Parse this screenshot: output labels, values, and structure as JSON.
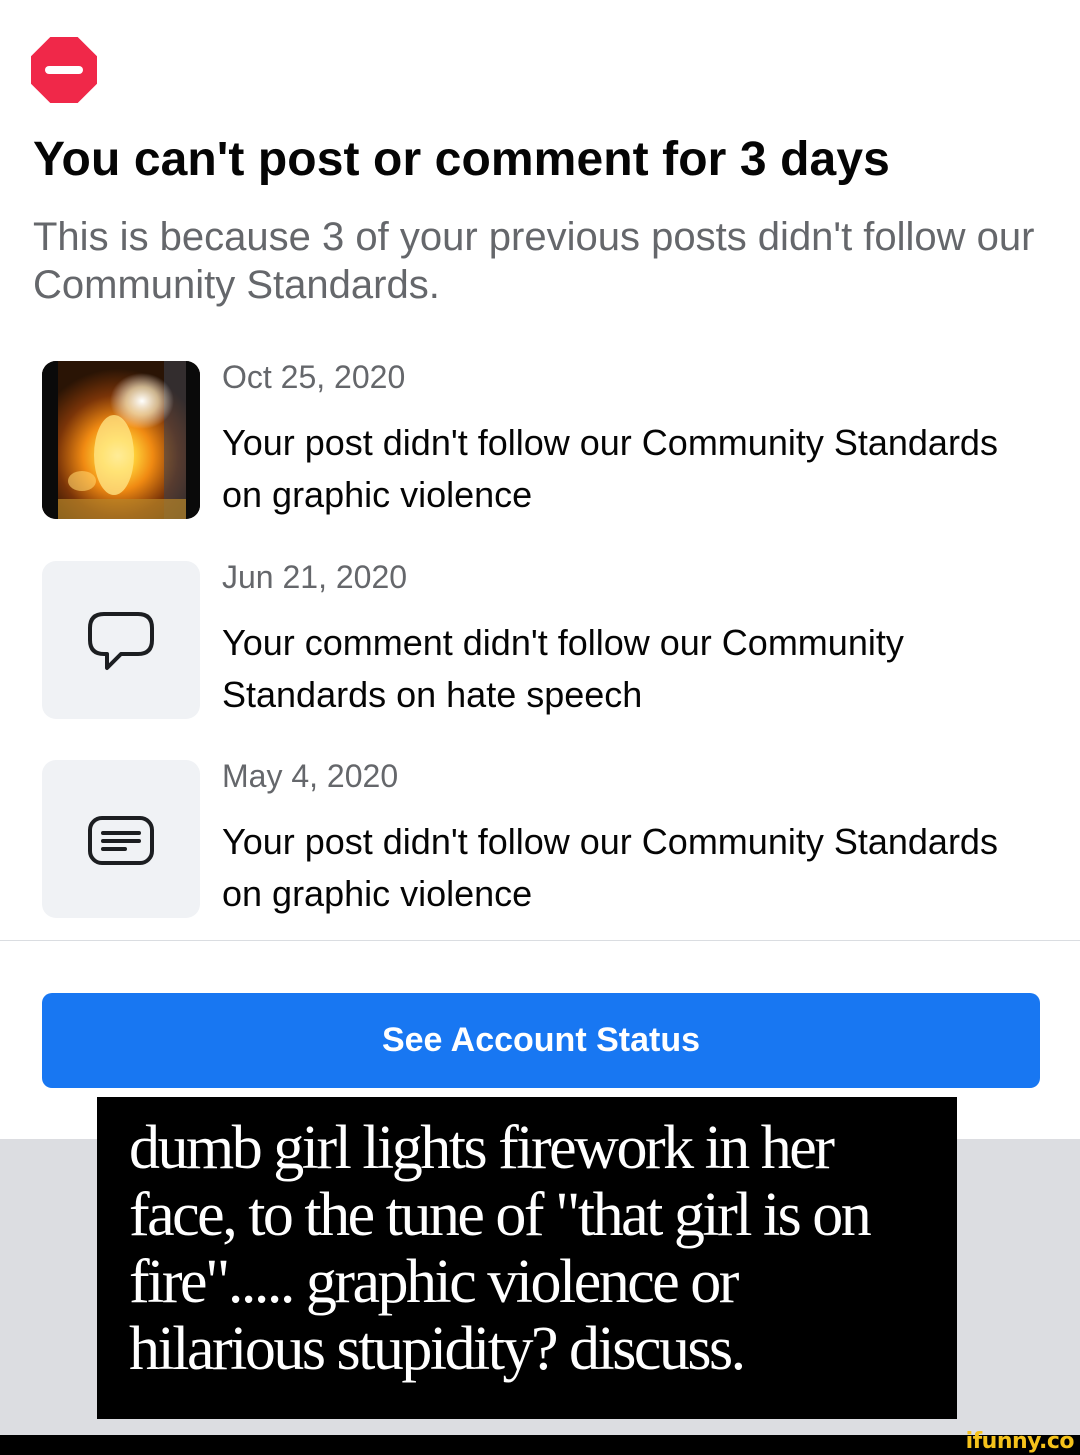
{
  "header": {
    "icon": "stop-sign-icon",
    "title": "You can't post or comment for 3 days",
    "subtitle": "This is because 3 of your previous posts didn't follow our Community Standards."
  },
  "violations": [
    {
      "date": "Oct 25, 2020",
      "text": "Your post didn't follow our Community Standards on graphic violence",
      "thumb": "fire-photo-thumbnail"
    },
    {
      "date": "Jun 21, 2020",
      "text": "Your comment didn't follow our Community Standards on hate speech",
      "icon": "comment-bubble-icon"
    },
    {
      "date": "May 4, 2020",
      "text": "Your post didn't follow our Community Standards on graphic violence",
      "icon": "post-text-icon"
    }
  ],
  "button": {
    "label": "See Account Status"
  },
  "caption": {
    "text": "dumb girl lights firework in her face, to the tune of \"that girl is on fire\"..... graphic violence or hilarious stupidity?  discuss."
  },
  "watermark": {
    "text": "ifunny.co"
  },
  "colors": {
    "accent": "#1877f2",
    "stop_red": "#f02849",
    "secondary_text": "#65676b",
    "watermark": "#f5c21b"
  }
}
